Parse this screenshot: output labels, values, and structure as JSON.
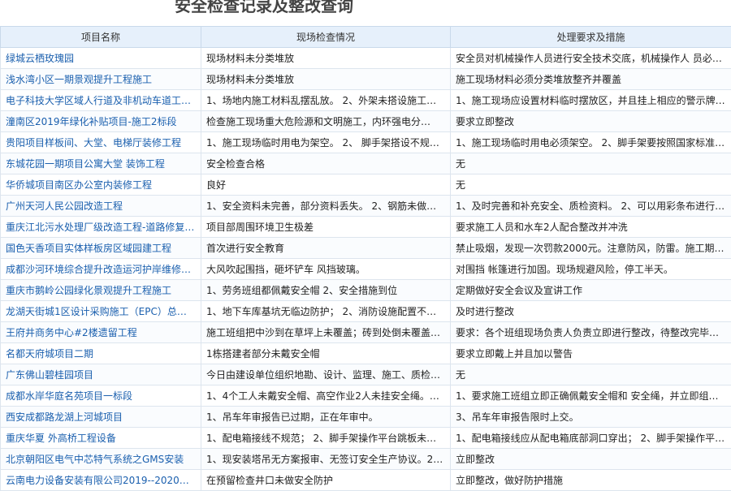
{
  "page": {
    "title": "安全检查记录及整改查询"
  },
  "table": {
    "columns": [
      "项目名称",
      "现场检查情况",
      "处理要求及措施"
    ],
    "rows": [
      [
        "绿城云栖玫瑰园",
        "现场材料未分类堆放",
        "安全员对机械操作人员进行安全技术交底，机械操作人 员必须…"
      ],
      [
        "浅水湾小区一期景观提升工程施工",
        "现场材料未分类堆放",
        "施工现场材料必须分类堆放整齐并覆盖"
      ],
      [
        "电子科技大学区域人行道及非机动车道工程施工",
        "1、场地内施工材料乱摆乱放。 2、外架未搭设施工通…",
        "1、施工现场应设置材料临时摆放区，并且挂上相应的警示牌。 …"
      ],
      [
        "潼南区2019年绿化补贴项目-施工2标段",
        "检查施工现场重大危险源和文明施工，内环强电分…",
        "要求立即整改"
      ],
      [
        "贵阳项目样板间、大堂、电梯厅装修工程",
        "1、施工现场临时用电为架空。 2、 脚手架搭设不规范…",
        "1、施工现场临时用电必须架空。 2、脚手架要按照国家标准进…"
      ],
      [
        "东城花园一期项目公寓大堂 装饰工程",
        "安全检查合格",
        "无"
      ],
      [
        "华侨城项目南区办公室内装修工程",
        "良好",
        "无"
      ],
      [
        "广州天河人民公园改造工程",
        "1、安全资料未完善，部分资料丢失。 2、钢筋未做防…",
        "1、及时完善和补充安全、质检资料。 2、可以用彩条布进行遮…"
      ],
      [
        "重庆江北污水处理厂级改造工程-道路修复工程",
        "项目部周围环境卫生极差",
        "要求施工人员和水车2人配合整改并冲洗"
      ],
      [
        "国色天香项目实体样板房区域园建工程",
        "首次进行安全教育",
        "禁止吸烟，发现一次罚款2000元。注意防风，防雷。施工期间…"
      ],
      [
        "成都沙河环境综合提升改造运河护岸维修改造",
        "大风吹起围挡，砸坏铲车 风挡玻璃。",
        "对围挡 帐篷进行加固。现场规避风险，停工半天。"
      ],
      [
        "重庆市鹅岭公园绿化景观提升工程施工",
        "1、劳务班组都佩戴安全帽 2、安全措施到位",
        "定期做好安全会议及宣讲工作"
      ],
      [
        "龙湖天街城1区设计采购施工（EPC）总承包工程",
        "1、地下车库基坑无临边防护； 2、消防设施配置不全…",
        "及时进行整改"
      ],
      [
        "王府井商务中心#2楼遗留工程",
        "施工班组把中沙到在草坪上未覆盖；砖到处倒未覆盖…",
        "要求：各个班组现场负责人负责立即进行整改，待整改完毕后经…"
      ],
      [
        "名都天府城项目二期",
        "1栋搭建者部分未戴安全帽",
        "要求立即戴上并且加以警告"
      ],
      [
        "广东佛山碧桂园项目",
        "今日由建设单位组织地勘、设计、监理、施工、质检…",
        "无"
      ],
      [
        "成都水岸华庭名苑项目一标段",
        "1、4个工人未戴安全帽、高空作业2人未挂安全绳。无…",
        "1、要求施工班组立即正确佩戴安全帽和 安全绳，并立即组织跳…"
      ],
      [
        "西安成都路龙湖上河城项目",
        "1、吊车年审报告已过期，正在年审中。",
        "3、吊车年审报告限时上交。"
      ],
      [
        "重庆华夏 外高桥工程设备",
        "1、配电箱接线不规范； 2、脚手架操作平台跳板未满…",
        "1、配电箱接线应从配电箱底部洞口穿出； 2、脚手架操作平台…"
      ],
      [
        "北京朝阳区电气中芯特气系统之GMS安装",
        "1、现安装塔吊无方案报审、无签订安全生产协议。2、…",
        "立即整改"
      ],
      [
        "云南电力设备安装有限公司2019--2020年度劳务…",
        "在预留检查井口未做安全防护",
        "立即整改，做好防护措施"
      ]
    ]
  }
}
